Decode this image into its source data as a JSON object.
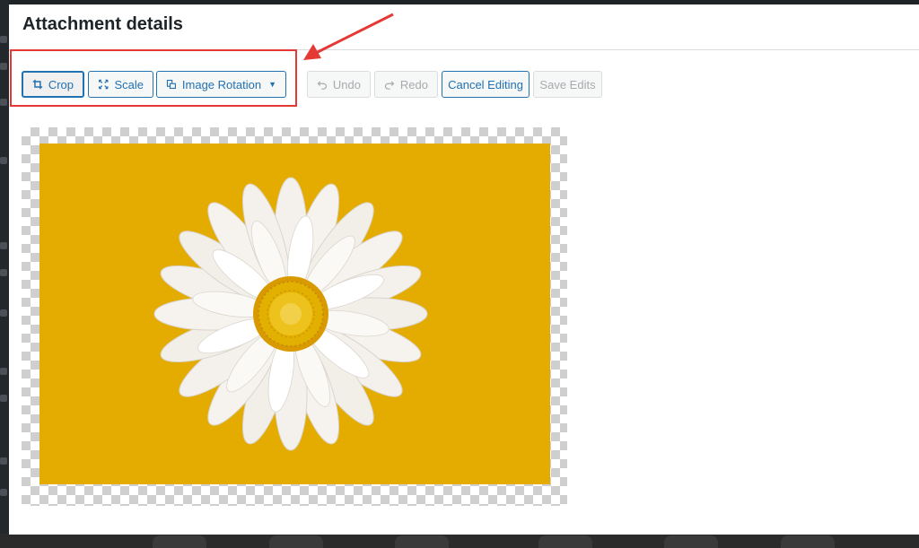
{
  "dialog": {
    "title": "Attachment details"
  },
  "toolbar": {
    "crop_label": "Crop",
    "scale_label": "Scale",
    "rotation_label": "Image Rotation",
    "undo_label": "Undo",
    "redo_label": "Redo",
    "cancel_label": "Cancel Editing",
    "save_label": "Save Edits"
  },
  "icons": {
    "crop": "crop-icon",
    "scale": "scale-icon",
    "rotation": "rotate-icon",
    "undo": "undo-icon",
    "redo": "redo-icon",
    "dropdown": "caret-down-icon"
  },
  "colors": {
    "accent": "#2271b1",
    "disabled": "#a7aaad",
    "highlight": "#e53935",
    "image_background": "#e4ac00",
    "flower_center": "#e2b000"
  }
}
